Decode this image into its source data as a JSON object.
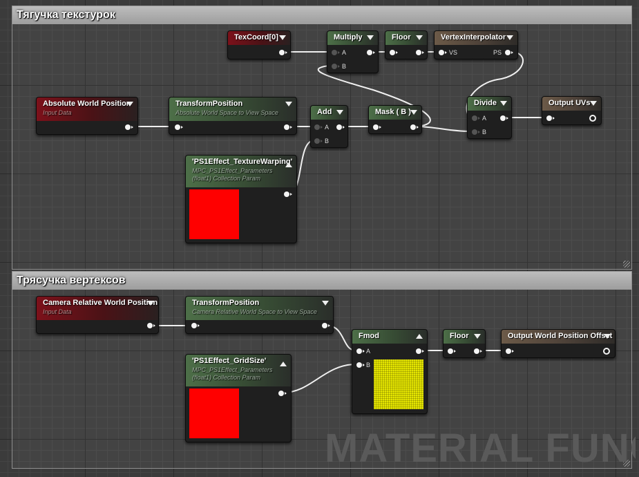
{
  "comments": [
    {
      "title": "Тягучка текстурок"
    },
    {
      "title": "Трясучка вертексов"
    }
  ],
  "watermark": "MATERIAL FUNCTI",
  "colors": {
    "wire": "#f0f0f0",
    "param_swatch": "#ff0000",
    "fmod_preview": "#e6e600"
  },
  "nodes": {
    "texcoord": {
      "title": "TexCoord[0]"
    },
    "multiply": {
      "title": "Multiply",
      "pins": [
        "A",
        "B"
      ]
    },
    "floor_top": {
      "title": "Floor"
    },
    "vertex_interp": {
      "title": "VertexInterpolator",
      "pin_in": "VS",
      "pin_out": "PS"
    },
    "abs_world_pos": {
      "title": "Absolute World Position",
      "subtitle": "Input Data"
    },
    "transform_top": {
      "title": "TransformPosition",
      "subtitle": "Absolute World Space to View Space"
    },
    "add": {
      "title": "Add",
      "pins": [
        "A",
        "B"
      ]
    },
    "mask": {
      "title": "Mask ( B )"
    },
    "divide": {
      "title": "Divide",
      "pins": [
        "A",
        "B"
      ]
    },
    "output_uvs": {
      "title": "Output UVs"
    },
    "texture_warping": {
      "title": "'PS1Effect_TextureWarping'",
      "subtitle1": "MPC_PS1Effect_Parameters",
      "subtitle2": "(float1) Collection Param"
    },
    "cam_world_pos": {
      "title": "Camera Relative World Position",
      "subtitle": "Input Data"
    },
    "transform_bottom": {
      "title": "TransformPosition",
      "subtitle": "Camera Relative World Space to View Space"
    },
    "fmod": {
      "title": "Fmod",
      "pins": [
        "A",
        "B"
      ]
    },
    "floor_bottom": {
      "title": "Floor"
    },
    "output_wpo": {
      "title": "Output World Position Offset"
    },
    "grid_size": {
      "title": "'PS1Effect_GridSize'",
      "subtitle1": "MPC_PS1Effect_Parameters",
      "subtitle2": "(float1) Collection Param"
    }
  }
}
